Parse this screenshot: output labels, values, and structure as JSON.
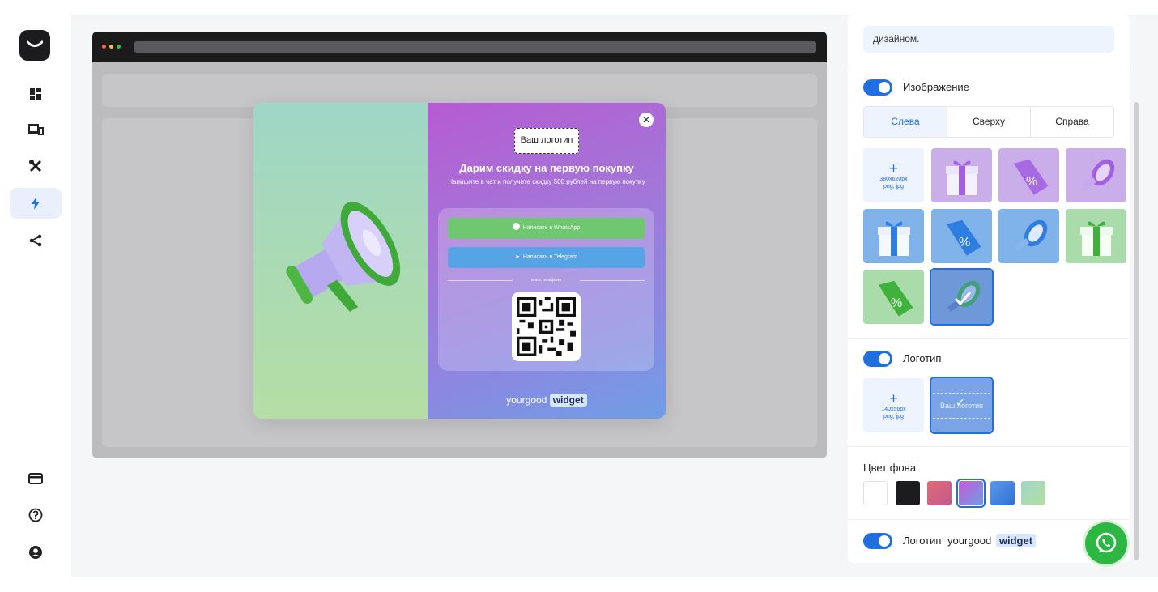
{
  "sidebar": {
    "items": [
      {
        "name": "dashboard-icon",
        "active": false
      },
      {
        "name": "devices-icon",
        "active": false
      },
      {
        "name": "tools-icon",
        "active": false
      },
      {
        "name": "lightning-icon",
        "active": true
      },
      {
        "name": "share-icon",
        "active": false
      }
    ],
    "bottom": [
      "card-icon",
      "help-icon",
      "user-icon"
    ]
  },
  "preview": {
    "logo_placeholder": "Ваш логотип",
    "title": "Дарим скидку на первую покупку",
    "subtitle": "Напишите в чат и получите скидку 500 рублей на первую покупку",
    "whatsapp_button": "Написать в WhatsApp",
    "telegram_button": "Написать в Telegram",
    "or_phone": "или с телефона",
    "brand_main": "yourgood",
    "brand_badge": "widget",
    "close": "✕"
  },
  "settings": {
    "note_text": "дизайном.",
    "image_section": {
      "label": "Изображение",
      "enabled": true,
      "tabs": [
        {
          "label": "Слева",
          "active": true
        },
        {
          "label": "Сверху",
          "active": false
        },
        {
          "label": "Справа",
          "active": false
        }
      ],
      "upload": {
        "plus": "+",
        "size": "380x620px",
        "format": "png, jpg"
      },
      "images": [
        "gift-purple",
        "tag-purple",
        "megaphone-purple",
        "gift-blue",
        "tag-blue",
        "megaphone-blue",
        "gift-green",
        "tag-green",
        "megaphone-green-selected"
      ]
    },
    "logo_section": {
      "label": "Логотип",
      "enabled": true,
      "upload": {
        "plus": "+",
        "size": "140x56px",
        "format": "png, jpg"
      },
      "selected_preview": "Ваш логотип"
    },
    "bg_color": {
      "label": "Цвет фона",
      "colors": [
        "#ffffff",
        "#1c1c1e",
        "#d06a7e",
        "#a05be0",
        "#3f7fe0",
        "#9ed9a8"
      ],
      "selected_index": 3
    },
    "brand_logo": {
      "label": "Логотип",
      "brand_main": "yourgood",
      "brand_badge": "widget",
      "enabled": true
    }
  }
}
